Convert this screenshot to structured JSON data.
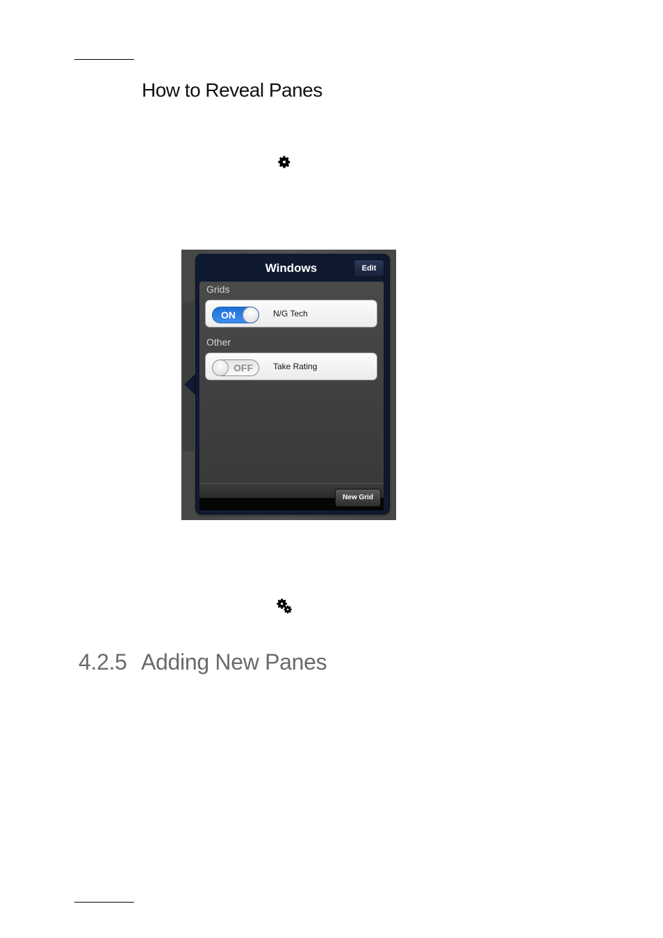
{
  "heading": "How to Reveal Panes",
  "section": {
    "number": "4.2.5",
    "title": "Adding New Panes"
  },
  "icons": {
    "gear": "gear-icon",
    "gears": "gears-icon"
  },
  "windows_popover": {
    "title": "Windows",
    "edit_label": "Edit",
    "sections": [
      {
        "label": "Grids",
        "item": {
          "toggle": "ON",
          "toggle_on": true,
          "label": "N/G Tech"
        }
      },
      {
        "label": "Other",
        "item": {
          "toggle": "OFF",
          "toggle_on": false,
          "label": "Take Rating"
        }
      }
    ],
    "new_grid_label": "New Grid"
  },
  "colors": {
    "popover_bg": "#0f1a30",
    "toggle_on": "#2f7fe6",
    "section_heading": "#6a6a6a"
  }
}
